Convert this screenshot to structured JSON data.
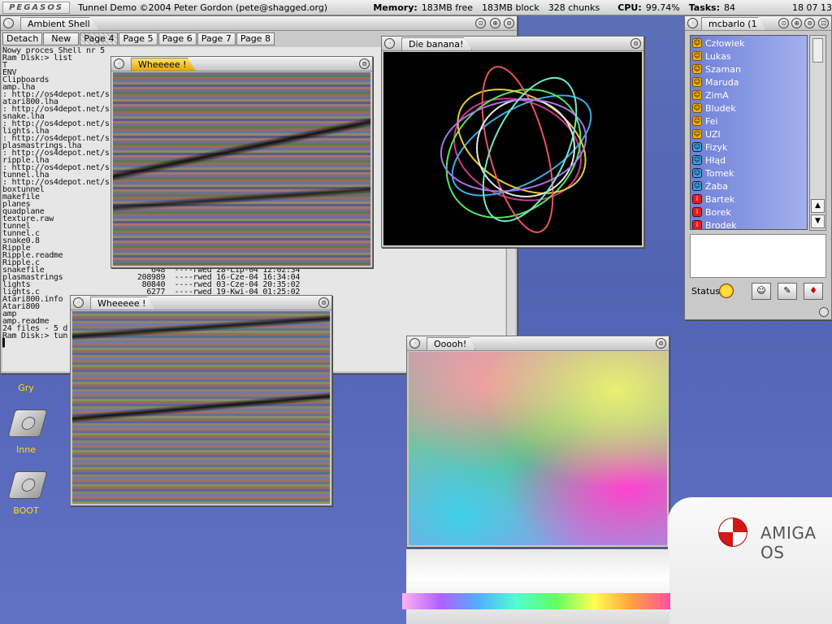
{
  "menubar": {
    "logo": "PEGASOS",
    "title": "Tunnel Demo ©2004 Peter Gordon (pete@shagged.org)",
    "memory_label": "Memory:",
    "memory_free": "183MB free",
    "memory_block": "183MB block",
    "memory_chunks": "328 chunks",
    "cpu_label": "CPU:",
    "cpu_value": "99.74%",
    "tasks_label": "Tasks:",
    "tasks_value": "84",
    "clock": "18 07 13"
  },
  "shell": {
    "title": "Ambient Shell",
    "tabs": [
      "Detach",
      "New",
      "Page 4",
      "Page 5",
      "Page 6",
      "Page 7",
      "Page 8"
    ],
    "active_tab": "Page 4",
    "lines": [
      "Nowy proces Shell nr 5",
      "Ram Disk:> list",
      "T",
      "ENV",
      "Clipboards",
      "amp.lha",
      ": http://os4depot.net/s",
      "atari800.lha",
      ": http://os4depot.net/s",
      "snake.lha",
      ": http://os4depot.net/s",
      "lights.lha",
      ": http://os4depot.net/s",
      "plasmastrings.lha",
      ": http://os4depot.net/s",
      "ripple.lha",
      ": http://os4depot.net/s",
      "tunnel.lha",
      ": http://os4depot.net/s",
      "boxtunnel",
      "makefile",
      "planes",
      "quadplane",
      "texture.raw",
      "tunnel",
      "tunnel.c",
      "snake0.8",
      "Ripple",
      "Ripple.readme",
      "Ripple.c",
      "snakefile                       648  ----rwed 28-Lip-04 12:02:34",
      "plasmastrings                208989  ----rwed 16-Cze-04 16:34:04",
      "lights                        80840  ----rwed 03-Cze-04 20:35:02",
      "lights.c                       6277  ----rwed 19-Kwi-04 01:25:02",
      "Atari800.info",
      "Atari800",
      "amp",
      "amp.readme",
      "24 files - 5 d",
      "Ram Disk:> tun",
      "▌"
    ]
  },
  "windows": {
    "wheee1_title": "Wheeeee !",
    "wheee2_title": "Wheeeee !",
    "banana_title": "Die banana!",
    "ooooh_title": "Ooooh!"
  },
  "desktop": {
    "gry_label": "Gry",
    "inne_label": "Inne",
    "boot_label": "BOOT"
  },
  "chat": {
    "title": "mcbarlo (1",
    "status_label": "Status",
    "buddies": [
      {
        "name": "Człowiek",
        "icon": "yellow"
      },
      {
        "name": "Lukas",
        "icon": "yellow"
      },
      {
        "name": "Szaman",
        "icon": "yellow"
      },
      {
        "name": "Maruda",
        "icon": "yellow"
      },
      {
        "name": "ZimA",
        "icon": "yellow"
      },
      {
        "name": "Bludek",
        "icon": "yellow"
      },
      {
        "name": "Fei",
        "icon": "yellow"
      },
      {
        "name": "UZI",
        "icon": "yellow"
      },
      {
        "name": "Fizyk",
        "icon": "blue"
      },
      {
        "name": "Hłąd",
        "icon": "blue"
      },
      {
        "name": "Tomek",
        "icon": "blue"
      },
      {
        "name": "Żaba",
        "icon": "blue"
      },
      {
        "name": "Bartek",
        "icon": "red"
      },
      {
        "name": "Borek",
        "icon": "red"
      },
      {
        "name": "Brodek",
        "icon": "red"
      }
    ]
  },
  "branding": {
    "os_name": "AMIGA OS"
  },
  "colors": {
    "desktop": "#5263b4",
    "active_tab": "#e2a800",
    "icon_label": "#ffe000",
    "buddy_list_bg": "#8a9ae0"
  }
}
